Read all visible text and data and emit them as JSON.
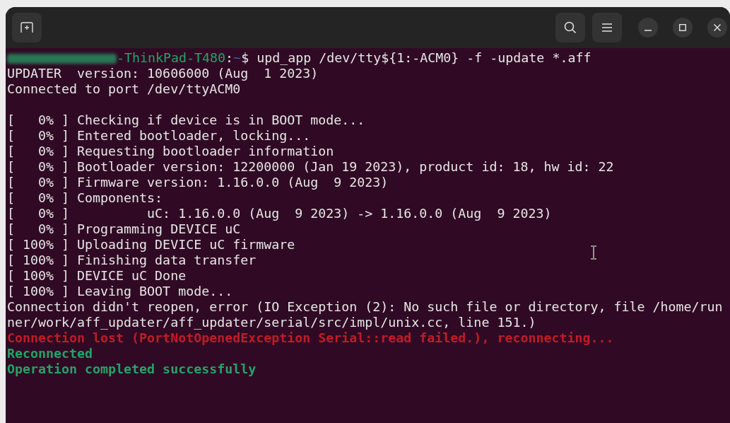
{
  "terminal": {
    "lines": [
      {
        "kind": "prompt",
        "host": "-ThinkPad-T480",
        "separator": ":",
        "path": "~",
        "symbol": "$",
        "command": " upd_app /dev/tty${1:-ACM0} -f -update *.aff"
      },
      {
        "kind": "plain",
        "text": "UPDATER  version: 10606000 (Aug  1 2023)"
      },
      {
        "kind": "plain",
        "text": "Connected to port /dev/ttyACM0"
      },
      {
        "kind": "blank"
      },
      {
        "kind": "plain",
        "text": "[   0% ] Checking if device is in BOOT mode..."
      },
      {
        "kind": "plain",
        "text": "[   0% ] Entered bootloader, locking..."
      },
      {
        "kind": "plain",
        "text": "[   0% ] Requesting bootloader information"
      },
      {
        "kind": "plain",
        "text": "[   0% ] Bootloader version: 12200000 (Jan 19 2023), product id: 18, hw id: 22"
      },
      {
        "kind": "plain",
        "text": "[   0% ] Firmware version: 1.16.0.0 (Aug  9 2023)"
      },
      {
        "kind": "plain",
        "text": "[   0% ] Components:"
      },
      {
        "kind": "plain",
        "text": "[   0% ]          uC: 1.16.0.0 (Aug  9 2023) -> 1.16.0.0 (Aug  9 2023)"
      },
      {
        "kind": "plain",
        "text": "[   0% ] Programming DEVICE uC"
      },
      {
        "kind": "plain",
        "text": "[ 100% ] Uploading DEVICE uC firmware"
      },
      {
        "kind": "plain",
        "text": "[ 100% ] Finishing data transfer"
      },
      {
        "kind": "plain",
        "text": "[ 100% ] DEVICE uC Done"
      },
      {
        "kind": "plain",
        "text": "[ 100% ] Leaving BOOT mode..."
      },
      {
        "kind": "plain",
        "text": "Connection didn't reopen, error (IO Exception (2): No such file or directory, file /home/run"
      },
      {
        "kind": "plain",
        "text": "ner/work/aff_updater/aff_updater/serial/src/impl/unix.cc, line 151.)"
      },
      {
        "kind": "error",
        "text": "Connection lost (PortNotOpenedException Serial::read failed.), reconnecting..."
      },
      {
        "kind": "success",
        "text": "Reconnected"
      },
      {
        "kind": "success",
        "text": "Operation completed successfully"
      }
    ]
  }
}
